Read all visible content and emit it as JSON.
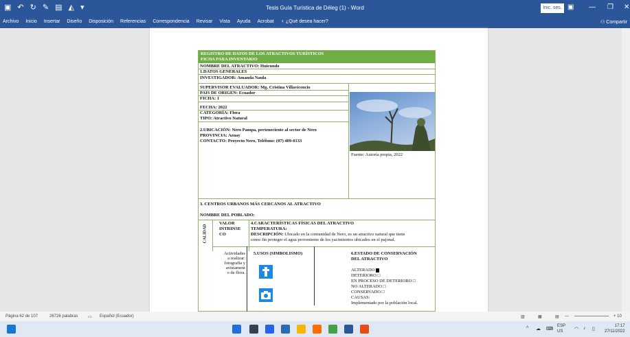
{
  "window": {
    "title": "Tesis Guía Turística de Déleg (1) - Word",
    "signin_label": "Inic. ses.",
    "qat_icons": [
      "save-icon",
      "undo-icon",
      "redo-icon",
      "brush-icon",
      "format-icon",
      "touch-icon",
      "customize-icon"
    ]
  },
  "ribbon": {
    "tabs": [
      "Archivo",
      "Inicio",
      "Insertar",
      "Diseño",
      "Disposición",
      "Referencias",
      "Correspondencia",
      "Revisar",
      "Vista",
      "Ayuda",
      "Acrobat"
    ],
    "tell_me": "¿Qué desea hacer?",
    "share": "Compartir"
  },
  "document": {
    "header_line1": "REGISTRO DE DATOS DE LOS ATRACTIVOS TURÍSTICOS",
    "header_line2": "FICHA PARA INVENTARIO",
    "nombre": "NOMBRE DEL ATRACTIVO: Huicundo",
    "datos_generales": "1.DATOS GENERALES",
    "investigador": "INVESTIGADOR: Amanda Naula",
    "supervisor": "SUPERVISOR EVALUADOR: Mg. Cristina Villavicencio",
    "pais": "PAIS DE ORIGEN: Ecuador",
    "ficha": "FICHA: 1",
    "fecha": "FECHA: 2022",
    "categoria": "CATEGORÍA: Flora",
    "tipo": "TIPO: Atractivo Natural",
    "ubicacion": "2.UBICACIÓN: Nero Pampa, perteneciente al sector     de Nero",
    "provincia": "PROVINCIA: Azuay",
    "contacto": "CONTACTO:  Proyecto Nero, Teléfono: (07) 409-0133",
    "fuente": "Fuente: Autoría propia, 2022",
    "centros": "3. CENTROS URBANOS MÁS CERCANOS AL ATRACTIVO",
    "poblado": "NOMBRE DEL POBLADO:",
    "valor_1": "VALOR",
    "valor_2": "INTRINSE",
    "valor_3": "CO",
    "calidad": "CALIDAD",
    "caracteristicas": "4.CARACTERÍSTICAS FÍSICAS DEL ATRACTIVO",
    "temperatura": "TEMPERATURA:",
    "descripcion_label": "DESCRIPCIÓN:",
    "descripcion_1": " Ubicado en la comunidad de Nero, es un atractivo natural que tiene",
    "descripcion_2": "como fin proteger el agua proveniente de los yacimientos ubicados en el pajonal.",
    "actividades": [
      "Actividades",
      "a realizar:",
      "fotografía y",
      "avistament",
      "o de flora."
    ],
    "usos": "5.USOS (SIMBOLISMO)",
    "estado_1": "6.ESTADO DE CONSERVACIÓN",
    "estado_2": "DEL ATRACTIVO",
    "alterado": "ALTERADO",
    "deterioro": "DETERIORO □",
    "proceso": "EN PROCESO DE DETERIORO □",
    "no_alterado": "NO ALTERADO □",
    "conservado": "CONSERVADO □",
    "causas": "CAUSAS:",
    "causas_text": "Implementado por la población local."
  },
  "status": {
    "page": "Página 62 de 107",
    "words": "26726 palabras",
    "language": "Español (Ecuador)",
    "zoom_plus": "+ 10"
  },
  "taskbar": {
    "lang1": "ESP",
    "lang2": "US",
    "time": "17:17",
    "date": "27/11/2022"
  },
  "colors": {
    "word_blue": "#2b579a",
    "table_green": "#70ad47"
  }
}
